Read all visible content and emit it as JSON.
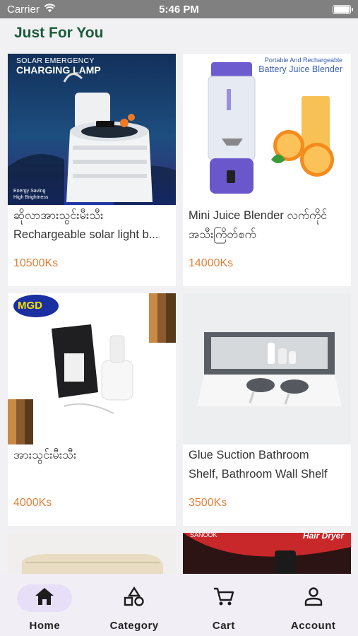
{
  "status_bar": {
    "carrier": "Carrier",
    "time": "5:46 PM"
  },
  "section": {
    "title": "Just For You"
  },
  "products": [
    {
      "image_caption": "SOLAR EMERGENCY",
      "image_caption2": "CHARGING LAMP",
      "image_features": [
        "Energy Saving",
        "High Brightness"
      ],
      "name_line1": "ဆိုလာအားသွင်းမီးသီး",
      "name_line2": "Rechargeable solar light b...",
      "price": "10500Ks"
    },
    {
      "image_caption": "Portable And Rechargeable",
      "image_caption2": "Battery Juice Blender",
      "name_line1": "Mini Juice Blender လက်ကိုင်",
      "name_line2": "အသီးကြိတ်စက်",
      "price": "14000Ks"
    },
    {
      "image_logo": "MGD",
      "name_line1": "အားသွင်းမီးသီး",
      "name_line2": "",
      "price": "4000Ks"
    },
    {
      "name_line1": "Glue Suction Bathroom",
      "name_line2": "Shelf, Bathroom Wall Shelf",
      "price": "3500Ks"
    }
  ],
  "partial_products": [
    {
      "image_caption": ""
    },
    {
      "image_caption": "SANOOK",
      "image_caption2": "Hair Dryer"
    }
  ],
  "tabbar": {
    "items": [
      {
        "label": "Home",
        "icon": "home-icon",
        "active": true
      },
      {
        "label": "Category",
        "icon": "category-icon",
        "active": false
      },
      {
        "label": "Cart",
        "icon": "cart-icon",
        "active": false
      },
      {
        "label": "Account",
        "icon": "account-icon",
        "active": false
      }
    ]
  },
  "colors": {
    "title": "#1a5c3a",
    "price": "#e2803a",
    "tab_active_bg": "#e7dff7",
    "tabbar_bg": "#f2eef6",
    "status_bar": "#808080"
  }
}
